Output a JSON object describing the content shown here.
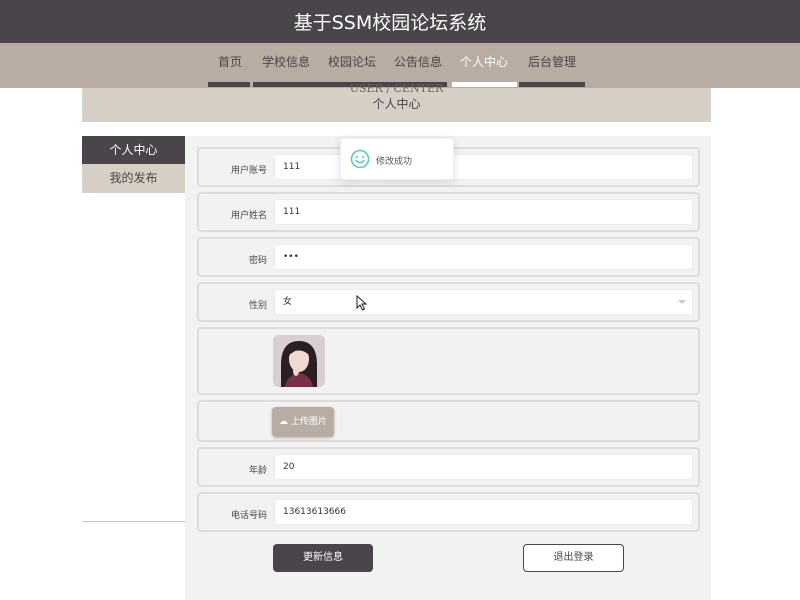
{
  "site": {
    "title": "基于SSM校园论坛系统"
  },
  "nav": {
    "items": [
      {
        "label": "首页"
      },
      {
        "label": "学校信息"
      },
      {
        "label": "校园论坛"
      },
      {
        "label": "公告信息"
      },
      {
        "label": "个人中心",
        "active": true
      },
      {
        "label": "后台管理"
      }
    ]
  },
  "banner": {
    "en": "USER / CENTER",
    "cn": "个人中心"
  },
  "sidebar": {
    "items": [
      {
        "label": "个人中心",
        "active": true
      },
      {
        "label": "我的发布"
      }
    ]
  },
  "form": {
    "account": {
      "label": "用户账号",
      "value": "111"
    },
    "name": {
      "label": "用户姓名",
      "value": "111"
    },
    "password": {
      "label": "密码",
      "value": "•••"
    },
    "gender": {
      "label": "性别",
      "value": "女"
    },
    "upload_label": "上传图片",
    "age": {
      "label": "年龄",
      "value": "20"
    },
    "phone": {
      "label": "电话号码",
      "value": "13613613666"
    }
  },
  "buttons": {
    "update": "更新信息",
    "logout": "退出登录"
  },
  "toast": {
    "message": "修改成功"
  },
  "colors": {
    "primary": "#4a444b",
    "accent": "#b8aca3",
    "banner": "#d6cfc5",
    "success": "#67c23a"
  }
}
